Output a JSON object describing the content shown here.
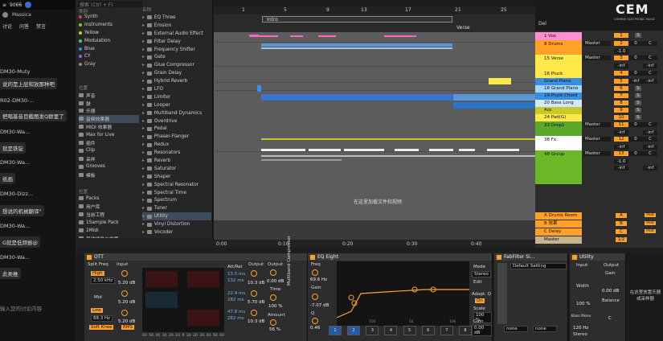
{
  "chat": {
    "header": "9066",
    "user": "Massica",
    "tabs": [
      "讨论",
      "问答",
      "禁言"
    ],
    "lines": [
      "DM30-Muty",
      "说的是上层和放那种吧",
      "R02-DM30-...",
      "把唱基音目截图发Q群里了",
      "DM30-Wa...",
      "就是铁锭",
      "DM30-Wa...",
      "纸画",
      "DM30-Dizz...",
      "想说的机械翻译\"",
      "DM30-Wa...",
      "G就是低频振@",
      "DM30-Wa...",
      "此类推"
    ],
    "input_placeholder": "输入您的讨论内容"
  },
  "browser": {
    "search": "搜索 (Ctrl + F)",
    "cat_header": "类别",
    "name_header": "名称",
    "categories": [
      "Synth",
      "Instruments",
      "Yellow",
      "Modulation",
      "Blue",
      "CY",
      "Gray"
    ],
    "category_colors": [
      "#e03c3c",
      "#8fbf3a",
      "#d8c81a",
      "#5bc26a",
      "#3a8ae0",
      "#9c5cd0",
      "#888888"
    ],
    "places_header": "位置",
    "places": [
      "声音",
      "鼓",
      "乐器",
      "音频效果器",
      "MIDI 效果器",
      "Max for Live",
      "插件",
      "Clip",
      "采样",
      "Grooves",
      "模板"
    ],
    "places2_header": "位置",
    "places2": [
      "Packs",
      "用户库",
      "当前工程",
      "1Sample Pack",
      "2Midi",
      "其他插件与效果"
    ],
    "items": [
      "EQ Three",
      "Erosion",
      "External Audio Effect",
      "Filter Delay",
      "Frequency Shifter",
      "Gate",
      "Glue Compressor",
      "Grain Delay",
      "Hybrid Reverb",
      "LFO",
      "Limiter",
      "Looper",
      "Multiband Dynamics",
      "Overdrive",
      "Pedal",
      "Phaser-Flanger",
      "Redux",
      "Resonators",
      "Reverb",
      "Saturator",
      "Shaper",
      "Spectral Resonator",
      "Spectral Time",
      "Spectrum",
      "Tuner",
      "Utility",
      "Vinyl Distortion",
      "Vocoder"
    ],
    "selected_item": "Utility",
    "selected_place": "音频效果器"
  },
  "arrangement": {
    "bars": [
      "1",
      "5",
      "9",
      "13",
      "17",
      "21",
      "25"
    ],
    "locators": [
      "Intro",
      "Verse"
    ],
    "drop_hint": "在这里加载文件和视频",
    "time_marks": [
      "0:00",
      "0:10",
      "0:20",
      "0:30",
      "0:40"
    ]
  },
  "mixer": {
    "header": "Del",
    "tracks": [
      {
        "name": "1 Vox",
        "color": "#ff8fd0",
        "num": "1",
        "input": "",
        "v1": "",
        "v2": ""
      },
      {
        "name": "8 Drums",
        "color": "#ffa128",
        "num": "2",
        "input": "Master",
        "v1": "0",
        "v2": "C"
      },
      {
        "name": "",
        "color": "#ffa128",
        "num": "",
        "input": "",
        "v1": "-1.0",
        "v2": ""
      },
      {
        "name": "15 Verse",
        "color": "#ffe84a",
        "num": "3",
        "input": "Master",
        "v1": "0",
        "v2": "C"
      },
      {
        "name": "",
        "color": "#ffe84a",
        "num": "",
        "input": "",
        "v1": "-inf",
        "v2": "-inf"
      },
      {
        "name": "16 Pluck",
        "color": "#ffe84a",
        "num": "4",
        "input": "",
        "v1": "0",
        "v2": "C"
      },
      {
        "name": "Grand Piano",
        "color": "#3b8de0",
        "num": "5",
        "input": "",
        "v1": "-inf",
        "v2": "-inf"
      },
      {
        "name": "18 Grand Piano",
        "color": "#a5d5ff",
        "num": "6",
        "input": "",
        "v1": "",
        "v2": ""
      },
      {
        "name": "19 Pluck Chord",
        "color": "#3b8de0",
        "num": "7",
        "input": "",
        "v1": "",
        "v2": ""
      },
      {
        "name": "20 Bass Long",
        "color": "#cfe8ff",
        "num": "8",
        "input": "",
        "v1": "",
        "v2": ""
      },
      {
        "name": "Arp",
        "color": "#c9c92a",
        "num": "9",
        "input": "",
        "v1": "",
        "v2": ""
      },
      {
        "name": "24 Pad(G)",
        "color": "#ffe84a",
        "num": "10",
        "input": "",
        "v1": "",
        "v2": ""
      },
      {
        "name": "33 Drop1",
        "color": "#5aa82a",
        "num": "11",
        "input": "Master",
        "v1": "0",
        "v2": "C"
      },
      {
        "name": "",
        "color": "#5aa82a",
        "num": "",
        "input": "",
        "v1": "-inf",
        "v2": "-inf"
      },
      {
        "name": "38 Fx",
        "color": "#ffffff",
        "num": "12",
        "input": "Master",
        "v1": "0",
        "v2": "C"
      },
      {
        "name": "",
        "color": "#ffffff",
        "num": "",
        "input": "",
        "v1": "-inf",
        "v2": "-inf"
      },
      {
        "name": "48 Group",
        "color": "#6ab82a",
        "num": "13",
        "input": "Master",
        "v1": "0",
        "v2": "C"
      },
      {
        "name": "",
        "color": "#6ab82a",
        "num": "",
        "input": "",
        "v1": "-1.0",
        "v2": ""
      },
      {
        "name": "",
        "color": "#6ab82a",
        "num": "",
        "input": "",
        "v1": "-inf",
        "v2": "-inf"
      }
    ],
    "returns": [
      {
        "name": "A Drums Room",
        "color": "#ffa128",
        "letter": "A",
        "post": "Post"
      },
      {
        "name": "B 效果",
        "color": "#ffa128",
        "letter": "B",
        "post": "Post"
      },
      {
        "name": "C Delay",
        "color": "#ffa128",
        "letter": "C",
        "post": "Post"
      },
      {
        "name": "Master",
        "color": "#c8b48a",
        "letter": "1/2",
        "post": ""
      }
    ]
  },
  "devices": {
    "ott": {
      "title": "OTT",
      "split": "Split Freq",
      "input": "Input",
      "high": "High",
      "high_freq": "2.50 kHz",
      "mid": "Mid",
      "low": "Low",
      "low_freq": "88.3 Hz",
      "soft_knee": "Soft Knee",
      "rms": "RMS",
      "in_db": [
        "5.20 dB",
        "5.20 dB",
        "5.20 dB"
      ],
      "attrel": "Att/Rel",
      "times": [
        "13.5 ms",
        "132 ms",
        "22.4 ms",
        "282 ms",
        "47.8 ms",
        "282 ms"
      ],
      "output": "Output",
      "out_vals": [
        "10.3 dB",
        "5.70 dB",
        "10.3 dB"
      ],
      "output2": "Output",
      "out2": "0.00 dB",
      "time": "Time",
      "time_val": "100 %",
      "amount": "Amount",
      "amount_val": "56 %",
      "multiband": "Multiband Compressor",
      "scale": [
        "60",
        "50",
        "40",
        "30",
        "20",
        "10",
        "0",
        "10",
        "20",
        "30",
        "40",
        "50",
        "60"
      ]
    },
    "eq": {
      "title": "EQ Eight",
      "freq": "Freq",
      "freq_val": "69.6 Hz",
      "gain": "Gain",
      "gain_val": "-7.07 dB",
      "q": "Q",
      "q_val": "0.46",
      "mode": "Mode",
      "mode_val": "Stereo",
      "edit": "Edit",
      "adapt": "Adapt. Q",
      "adapt_val": "On",
      "scale": "Scale",
      "scale_val": "100 %",
      "gain2": "Gain",
      "gain2_val": "0.00 dB",
      "bands": [
        "1",
        "2",
        "3",
        "4",
        "5",
        "6",
        "7",
        "8"
      ],
      "freq_labels": [
        "100",
        "1k",
        "10k"
      ]
    },
    "fab": {
      "title": "FabFilter Si...",
      "preset": "Default Setting",
      "none": "none"
    },
    "utility": {
      "title": "Utility",
      "input": "Input",
      "output": "Output",
      "gain": "Gain",
      "gain_val": "0.00 dB",
      "width": "Width",
      "width_val": "100 %",
      "balance": "Balance",
      "balance_val": "C",
      "bass_mono": "Bass Mono",
      "bass_freq": "120 Hz",
      "stereo": "Stereo"
    },
    "hint": "在这里放置乐器或采样器"
  },
  "logo": {
    "text": "CEM",
    "sub": "CHINESE ELECTRONIC MUSIC"
  }
}
